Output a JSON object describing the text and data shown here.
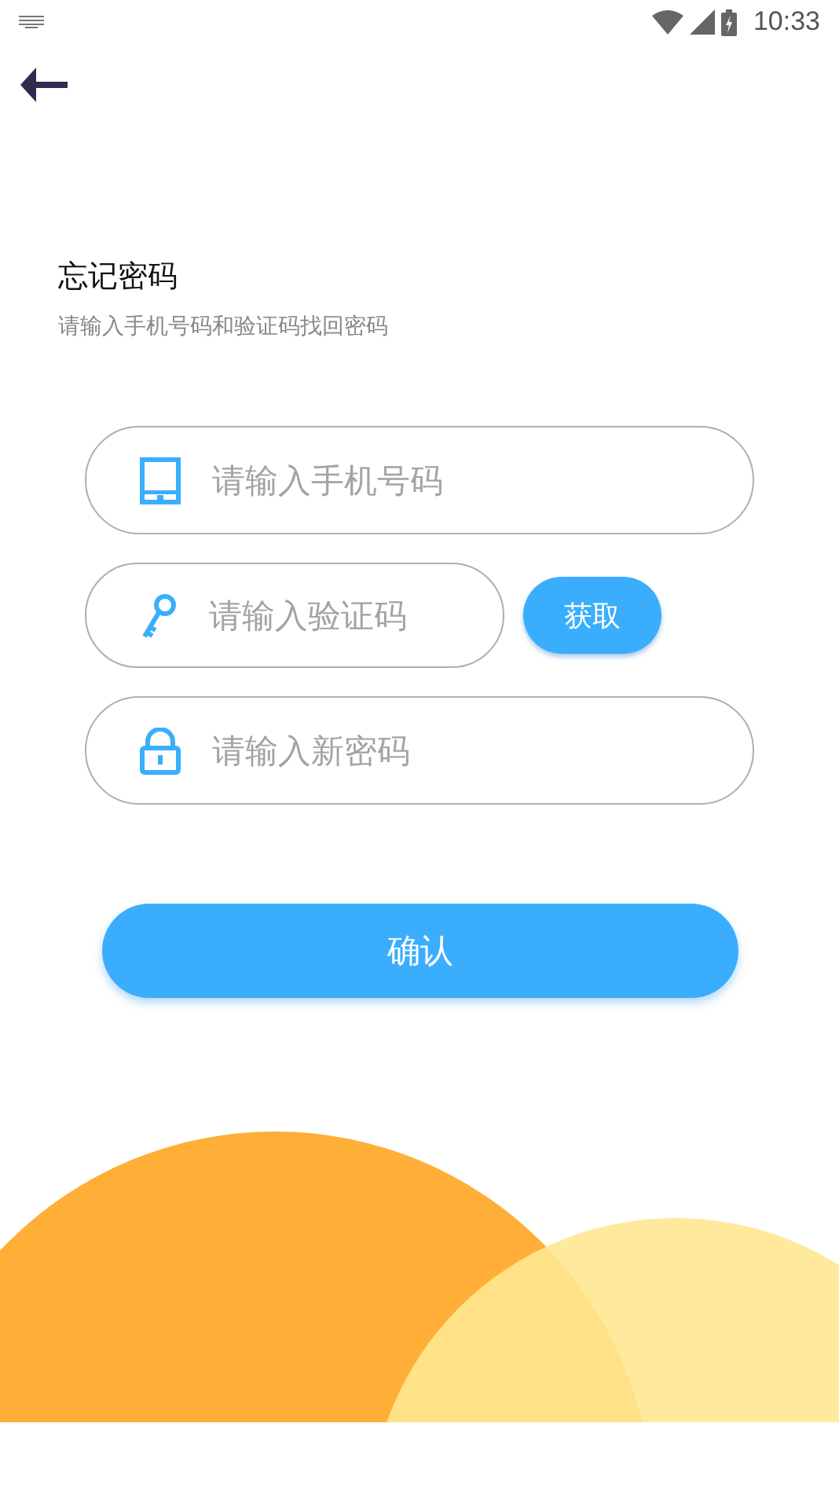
{
  "status_bar": {
    "time": "10:33"
  },
  "title": "忘记密码",
  "subtitle": "请输入手机号码和验证码找回密码",
  "fields": [
    {
      "kind": "phone",
      "placeholder": "请输入手机号码"
    },
    {
      "kind": "code",
      "placeholder": "请输入验证码",
      "button": "获取"
    },
    {
      "kind": "password",
      "placeholder": "请输入新密码"
    }
  ],
  "confirm_button": "确认"
}
